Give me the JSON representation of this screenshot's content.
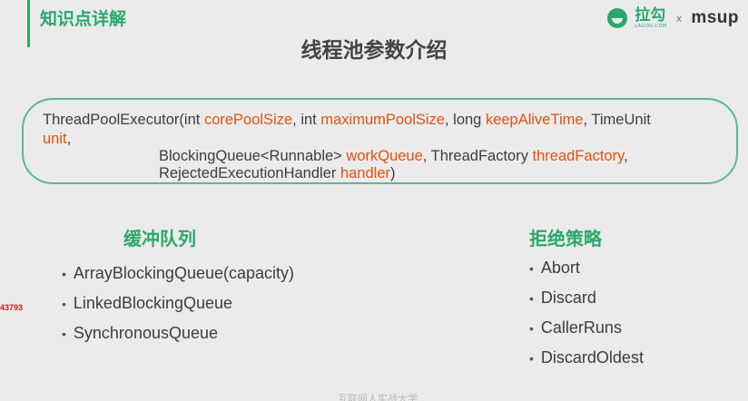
{
  "header": {
    "section_label": "知识点详解",
    "title": "线程池参数介绍",
    "logo_lagou": "拉勾",
    "logo_lagou_sub": "LAGOU.COM",
    "logo_x": "x",
    "logo_msup": "msup"
  },
  "code": {
    "line1": [
      {
        "text": "ThreadPoolExecutor(int ",
        "hl": false
      },
      {
        "text": "corePoolSize",
        "hl": true
      },
      {
        "text": ", int ",
        "hl": false
      },
      {
        "text": "maximumPoolSize",
        "hl": true
      },
      {
        "text": ", long ",
        "hl": false
      },
      {
        "text": "keepAliveTime",
        "hl": true
      },
      {
        "text": ", TimeUnit",
        "hl": false
      }
    ],
    "line2": [
      {
        "text": "unit",
        "hl": true
      },
      {
        "text": ",",
        "hl": false
      }
    ],
    "line3": [
      {
        "text": "BlockingQueue<Runnable> ",
        "hl": false
      },
      {
        "text": "workQueue",
        "hl": true
      },
      {
        "text": ", ThreadFactory ",
        "hl": false
      },
      {
        "text": "threadFactory",
        "hl": true
      },
      {
        "text": ",",
        "hl": false
      }
    ],
    "line4": [
      {
        "text": "RejectedExecutionHandler ",
        "hl": false
      },
      {
        "text": "handler",
        "hl": true
      },
      {
        "text": ")",
        "hl": false
      }
    ]
  },
  "queues": {
    "heading": "缓冲队列",
    "items": [
      "ArrayBlockingQueue(capacity)",
      "LinkedBlockingQueue",
      "SynchronousQueue"
    ]
  },
  "policies": {
    "heading": "拒绝策略",
    "items": [
      "Abort",
      "Discard",
      "CallerRuns",
      "DiscardOldest"
    ]
  },
  "side_number": "43793",
  "watermark": "互联网人实战大学",
  "colors": {
    "accent": "#2aa86a",
    "highlight": "#e5500f",
    "border": "#5bb899"
  }
}
